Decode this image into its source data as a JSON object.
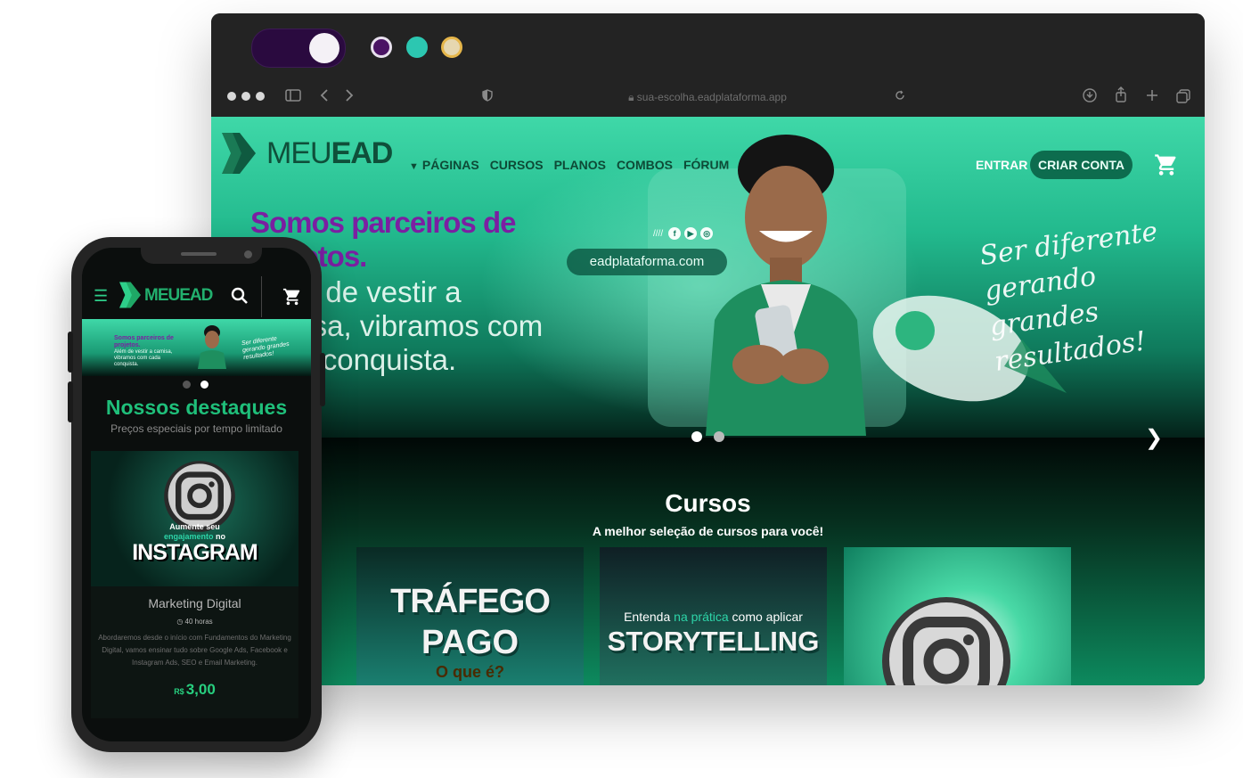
{
  "theme_swatches": [
    "#4a1364",
    "#2cc7b1",
    "#e6d7b0"
  ],
  "browser": {
    "url": "sua-escolha.eadplataforma.app",
    "icons": [
      "sidebar-icon",
      "back-icon",
      "forward-icon",
      "shield-icon",
      "reload-icon",
      "download-icon",
      "share-icon",
      "new-tab-icon",
      "tabs-overview-icon"
    ]
  },
  "site": {
    "logo_prefix": "MEU",
    "logo_suffix": "EAD",
    "nav": [
      "PÁGINAS",
      "CURSOS",
      "PLANOS",
      "COMBOS",
      "FÓRUM"
    ],
    "login_label": "ENTRAR",
    "signup_label": "CRIAR CONTA",
    "hero": {
      "title": "Somos parceiros de projetos.",
      "subtitle": "Além de vestir a camisa, vibramos com cada conquista.",
      "url_pill": "eadplataforma.com",
      "script_text": "Ser diferente gerando grandes resultados!",
      "slides_active": 1,
      "slides_total": 2
    },
    "cursos": {
      "title": "Cursos",
      "subtitle": "A melhor seleção de cursos para você!",
      "cards": [
        {
          "line1": "TRÁFEGO",
          "line2": "PAGO",
          "line3": "O que é?"
        },
        {
          "line1_pre": "Entenda ",
          "line1_accent": "na prática",
          "line1_post": " como aplicar",
          "line2": "STORYTELLING"
        },
        {
          "icon": "instagram-icon"
        }
      ]
    }
  },
  "mobile": {
    "logo": "MEUEAD",
    "banner_title": "Somos parceiros de projetos.",
    "banner_sub": "Além de vestir a camisa, vibramos com cada conquista.",
    "banner_script": "Ser diferente gerando grandes resultados!",
    "section_title": "Nossos destaques",
    "section_sub": "Preços especiais por tempo limitado",
    "card": {
      "img_line1": "Aumente seu",
      "img_line2_accent": "engajamento",
      "img_line2_post": " no",
      "img_line3": "INSTAGRAM",
      "category": "Marketing Digital",
      "duration": "40 horas",
      "description": "Abordaremos desde o início com Fundamentos do Marketing Digital, vamos ensinar tudo sobre Google Ads, Facebook e Instagram Ads, SEO e Email Marketing.",
      "currency": "R$",
      "price": "3,00"
    }
  }
}
